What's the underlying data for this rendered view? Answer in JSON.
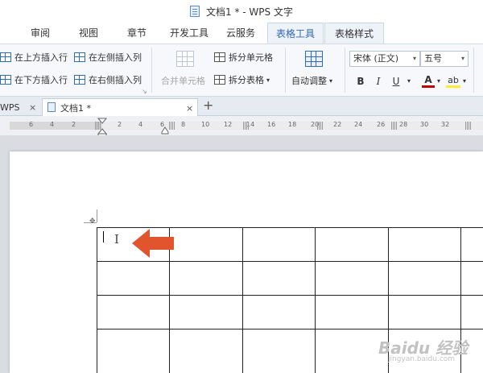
{
  "title_bar": {
    "title": "文档1 * - WPS 文字"
  },
  "menu": {
    "tabs": [
      "审阅",
      "视图",
      "章节",
      "开发工具",
      "云服务",
      "表格工具",
      "表格样式"
    ]
  },
  "ribbon": {
    "insert_row_above": "在上方插入行",
    "insert_row_below": "在下方插入行",
    "insert_col_left": "在左侧插入列",
    "insert_col_right": "在右侧插入列",
    "merge_cells": "合并单元格",
    "split_cells": "拆分单元格",
    "split_table": "拆分表格",
    "split_table_arrow": "▾",
    "auto_fit": "自动调整",
    "auto_fit_arrow": "▾",
    "font_name": "宋体 (正文)",
    "font_size": "五号",
    "bold": "B",
    "italic": "I",
    "underline": "U",
    "font_color_letter": "A",
    "highlight_letter": "ab",
    "underline_arrow": "▾",
    "font_color_arrow": "▾",
    "highlight_arrow": "▾",
    "dropdown_arrow": "▾",
    "dialog_launcher": "↘"
  },
  "doc_tabs": {
    "wps_tab": "WPS",
    "doc_tab": "文档1 *",
    "close_glyph": "×",
    "new_tab_glyph": "+"
  },
  "ruler": {
    "numbers_left": [
      "6",
      "4",
      "2",
      "2",
      "4"
    ],
    "numbers_right": [
      "6",
      "8",
      "10",
      "12",
      "14",
      "16",
      "18",
      "20",
      "22",
      "24",
      "26",
      "28",
      "30",
      "32"
    ]
  },
  "table": {
    "rows": 4,
    "cols": 5
  },
  "cursor": {
    "ibeam_glyph": "I"
  },
  "move_glyph": "✥",
  "watermark": {
    "text": "Baidu 经验",
    "url": "jingyan.baidu.com"
  },
  "colors": {
    "accent": "#2f66b1",
    "arrow": "#e0542e",
    "font_color": "#c00000",
    "highlight": "#ffeb3b"
  }
}
